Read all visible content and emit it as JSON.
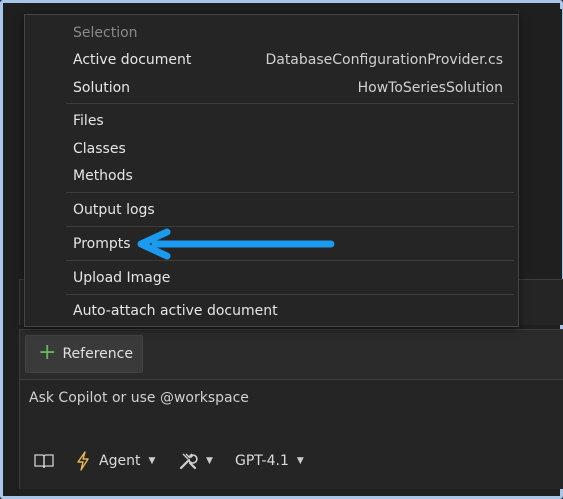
{
  "menu": {
    "section_header": "Selection",
    "items": [
      {
        "label": "Active document",
        "value": "DatabaseConfigurationProvider.cs"
      },
      {
        "label": "Solution",
        "value": "HowToSeriesSolution"
      },
      {
        "label": "Files"
      },
      {
        "label": "Classes"
      },
      {
        "label": "Methods"
      },
      {
        "label": "Output logs"
      },
      {
        "label": "Prompts"
      },
      {
        "label": "Upload Image"
      },
      {
        "label": "Auto-attach active document"
      }
    ]
  },
  "chat": {
    "reference_label": "Reference",
    "input_placeholder": "Ask Copilot or use @workspace",
    "mode_label": "Agent",
    "model_label": "GPT-4.1"
  },
  "icons": {
    "reference": "plus-icon",
    "docs": "book-icon",
    "mode": "lightning-icon",
    "tools": "tools-icon",
    "annotation": "blue-arrow-annotation"
  },
  "colors": {
    "accent_arrow": "#1a9bf0",
    "plus": "#5fb85f",
    "lightning": "#e8b84a"
  }
}
